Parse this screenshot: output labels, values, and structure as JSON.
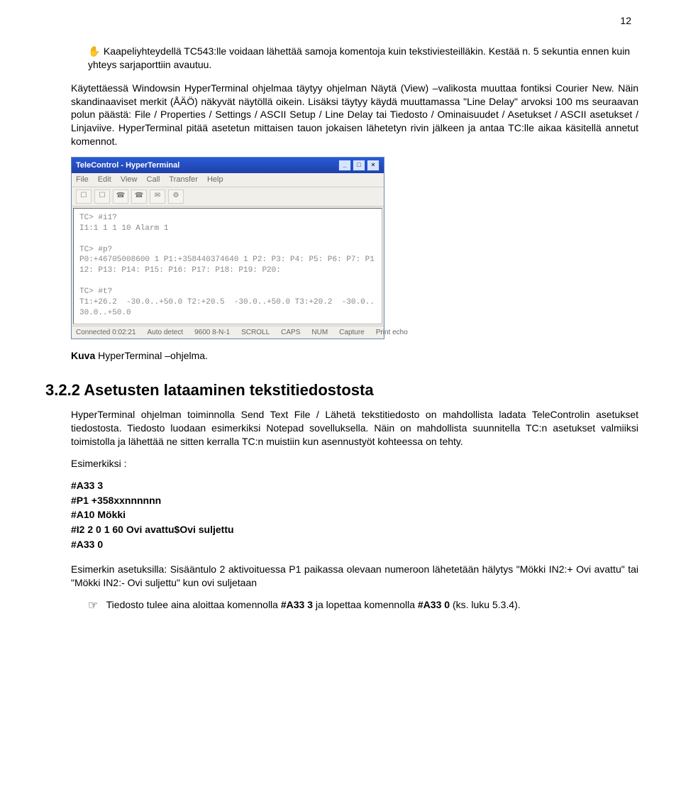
{
  "page_number": "12",
  "callout1": {
    "icon": "✋",
    "text": "Kaapeliyhteydellä TC543:lle voidaan lähettää samoja komentoja kuin tekstiviesteilläkin. Kestää n. 5 sekuntia ennen kuin yhteys sarjaporttiin avautuu."
  },
  "para1": "Käytettäessä Windowsin HyperTerminal ohjelmaa täytyy ohjelman Näytä (View) –valikosta muuttaa fontiksi Courier New. Näin skandinaaviset merkit (ÅÄÖ) näkyvät näytöllä oikein. Lisäksi täytyy käydä muuttamassa \"Line Delay\" arvoksi 100 ms seuraavan polun päästä: File / Properties / Settings / ASCII Setup / Line Delay tai Tiedosto / Ominaisuudet / Asetukset / ASCII asetukset / Linjaviive. HyperTerminal pitää asetetun mittaisen tauon jokaisen lähetetyn rivin jälkeen ja antaa TC:lle aikaa käsitellä annetut komennot.",
  "ht": {
    "title": "TeleControl - HyperTerminal",
    "menu": {
      "file": "File",
      "edit": "Edit",
      "view": "View",
      "call": "Call",
      "transfer": "Transfer",
      "help": "Help"
    },
    "term_lines": "TC> #i1?\nI1:1 1 1 10 Alarm 1\n\nTC> #p?\nP0:+46705008600 1 P1:+358440374640 1 P2: P3: P4: P5: P6: P7: P1\n12: P13: P14: P15: P16: P17: P18: P19: P20:\n\nTC> #t?\nT1:+26.2  -30.0..+50.0 T2:+20.5  -30.0..+50.0 T3:+20.2  -30.0..\n30.0..+50.0",
    "status": {
      "conn": "Connected 0:02:21",
      "auto": "Auto detect",
      "baud": "9600 8-N-1",
      "scroll": "SCROLL",
      "caps": "CAPS",
      "num": "NUM",
      "capture": "Capture",
      "echo": "Print echo"
    }
  },
  "caption": {
    "label": "Kuva",
    "text": " HyperTerminal –ohjelma."
  },
  "section": "3.2.2 Asetusten lataaminen tekstitiedostosta",
  "para2": "HyperTerminal ohjelman toiminnolla  Send Text File / Lähetä tekstitiedosto on mahdollista ladata TeleControlin asetukset tiedostosta. Tiedosto luodaan esimerkiksi Notepad sovelluksella.  Näin on mahdollista suunnitella TC:n asetukset valmiiksi toimistolla ja lähettää ne sitten kerralla TC:n muistiin kun asennustyöt kohteessa on tehty.",
  "example_label": "Esimerkiksi :",
  "examples": {
    "l1": "#A33 3",
    "l2": "#P1 +358xxnnnnnn",
    "l3": "#A10 Mökki",
    "l4": "#I2 2 0 1 60 Ovi avattu$Ovi suljettu",
    "l5": "#A33 0"
  },
  "para3": "Esimerkin asetuksilla: Sisääntulo 2 aktivoituessa P1 paikassa olevaan numeroon lähetetään hälytys \"Mökki IN2:+ Ovi avattu\" tai \"Mökki IN2:- Ovi suljettu\" kun ovi suljetaan",
  "footer": {
    "icon": "☞",
    "pre": "Tiedosto tulee aina aloittaa komennolla ",
    "cmd1": "#A33 3",
    "mid": "  ja lopettaa komennolla ",
    "cmd2": "#A33 0",
    "post": " (ks. luku 5.3.4)."
  }
}
